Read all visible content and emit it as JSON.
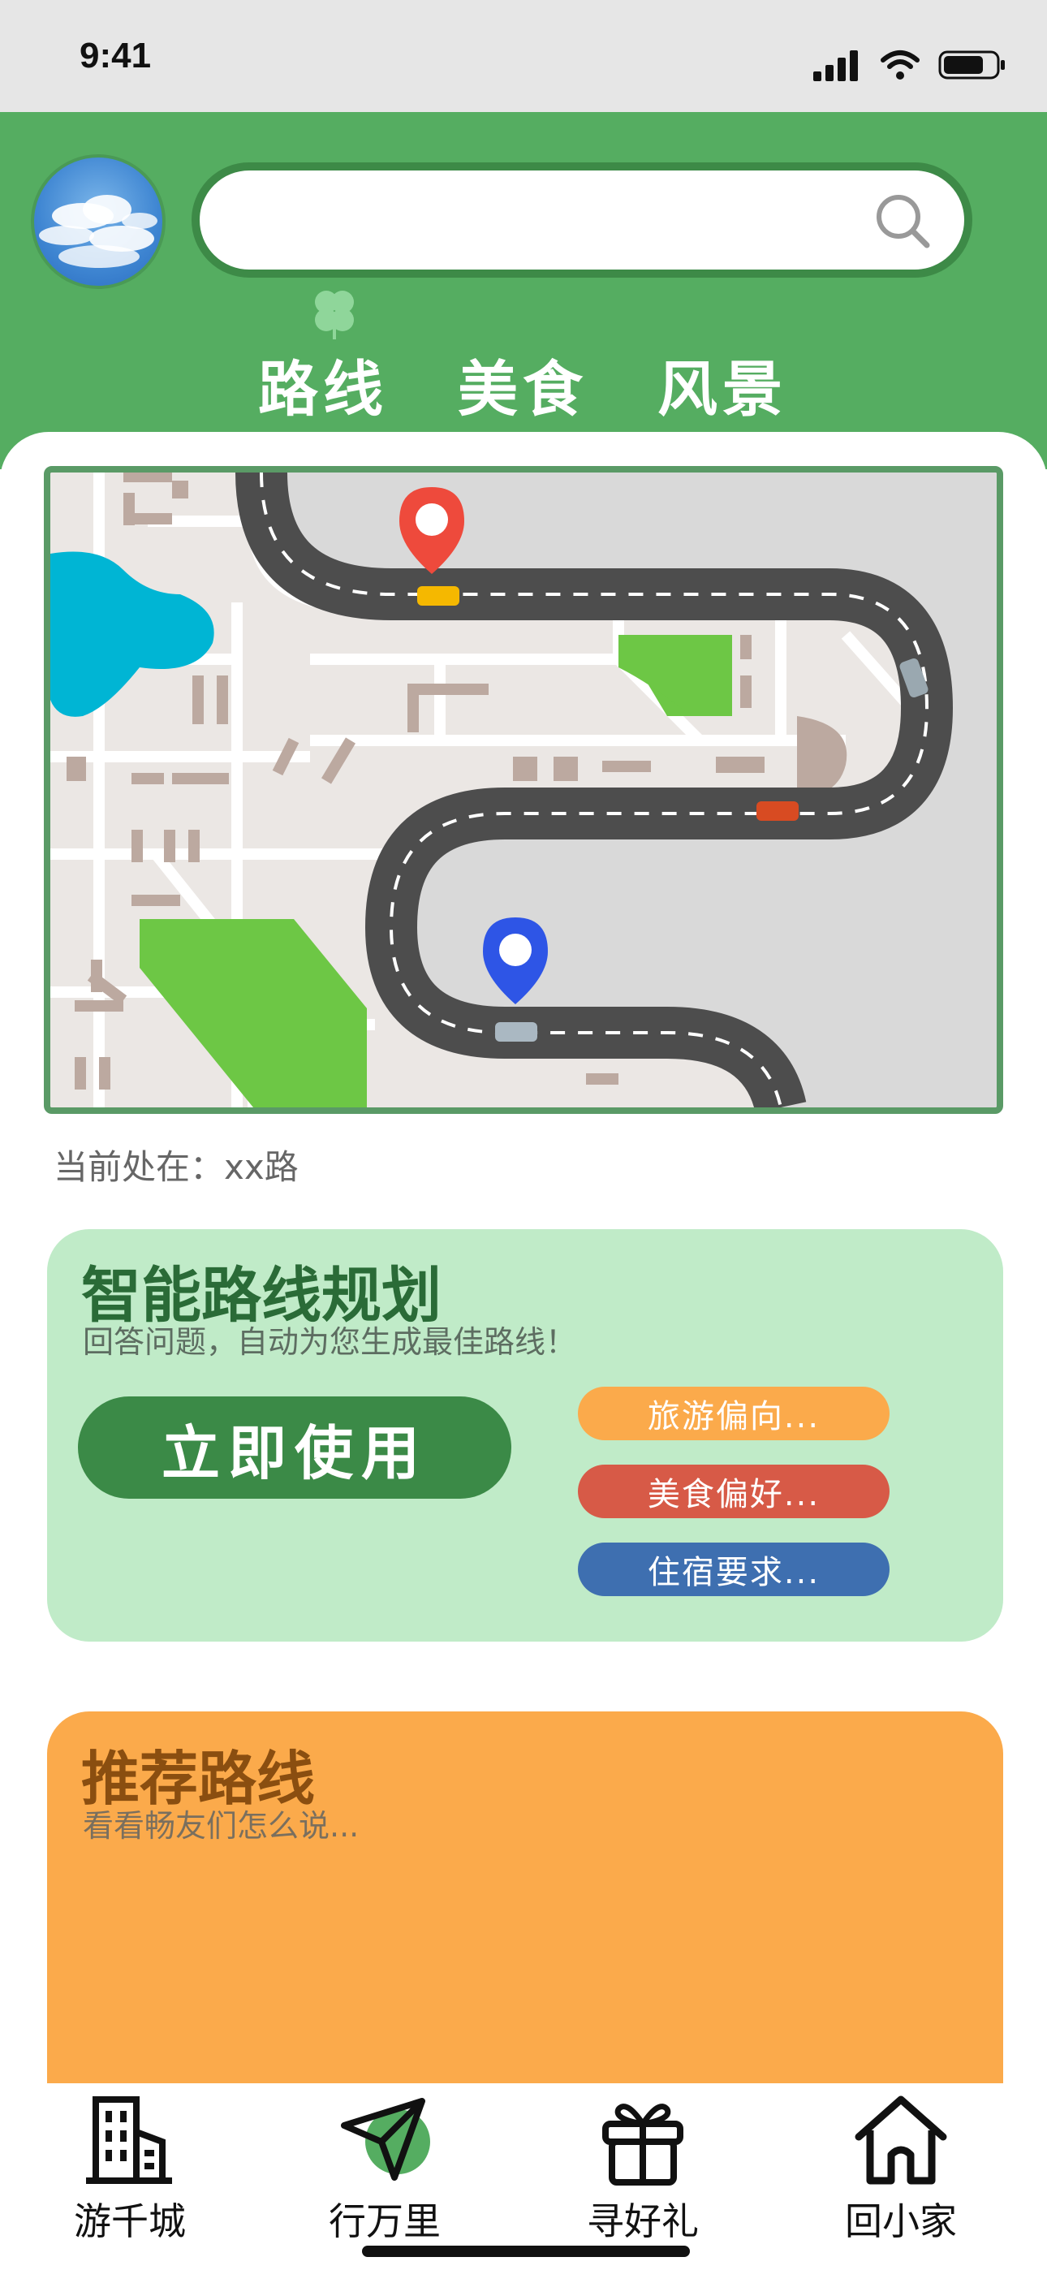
{
  "status_bar": {
    "time": "9:41"
  },
  "header": {
    "search": {
      "placeholder": ""
    },
    "tabs": [
      {
        "label": "路线"
      },
      {
        "label": "美食"
      },
      {
        "label": "风景"
      }
    ]
  },
  "map": {
    "location_text": "当前处在：xx路"
  },
  "plan_card": {
    "title": "智能路线规划",
    "subtitle": "回答问题，自动为您生成最佳路线！",
    "use_button": "立即使用",
    "preferences": [
      {
        "label": "旅游偏向...",
        "color": "#fbaa4b"
      },
      {
        "label": "美食偏好...",
        "color": "#d75a47"
      },
      {
        "label": "住宿要求...",
        "color": "#3e6fb0"
      }
    ]
  },
  "recommend_card": {
    "title": "推荐路线",
    "subtitle": "看看畅友们怎么说..."
  },
  "bottom_nav": [
    {
      "label": "游千城",
      "icon": "building-icon"
    },
    {
      "label": "行万里",
      "icon": "paper-plane-icon"
    },
    {
      "label": "寻好礼",
      "icon": "gift-icon"
    },
    {
      "label": "回小家",
      "icon": "home-icon"
    }
  ],
  "colors": {
    "header_green": "#55ad61",
    "plan_card_bg": "#c0ebc8",
    "recommend_card_bg": "#fbaa4b"
  }
}
